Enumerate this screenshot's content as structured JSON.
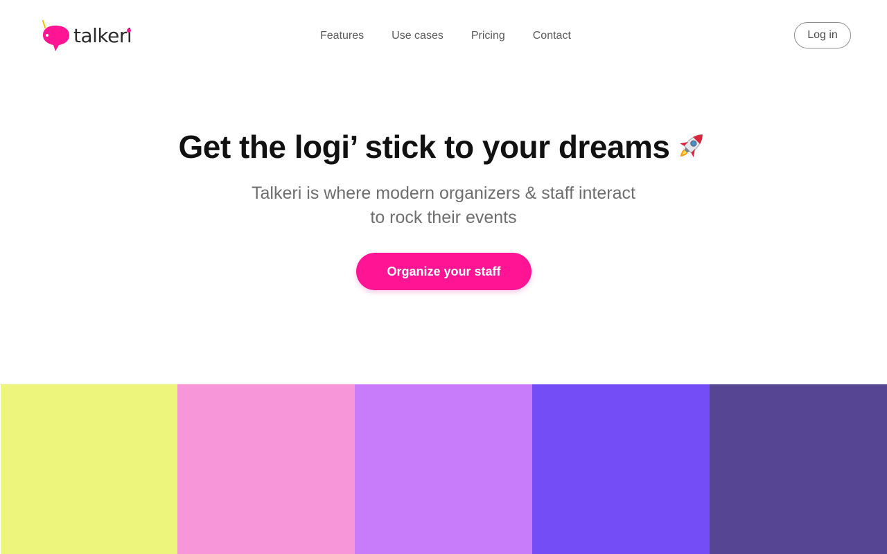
{
  "brand": {
    "name": "talkeri",
    "logo_color": "#ff1493",
    "logo_icon": "speech-bubble-bird-icon"
  },
  "nav": {
    "items": [
      {
        "label": "Features"
      },
      {
        "label": "Use cases"
      },
      {
        "label": "Pricing"
      },
      {
        "label": "Contact"
      }
    ],
    "login_label": "Log in"
  },
  "hero": {
    "title": "Get the logi’ stick to your dreams",
    "title_icon": "rocket-icon",
    "subtitle_line1": "Talkeri is where modern organizers & staff interact",
    "subtitle_line2": "to rock their events",
    "cta_label": "Organize your staff",
    "cta_color": "#ff1493"
  },
  "palette": {
    "colors": [
      "#eef57d",
      "#f796d8",
      "#c87cfa",
      "#754df6",
      "#554592"
    ]
  }
}
